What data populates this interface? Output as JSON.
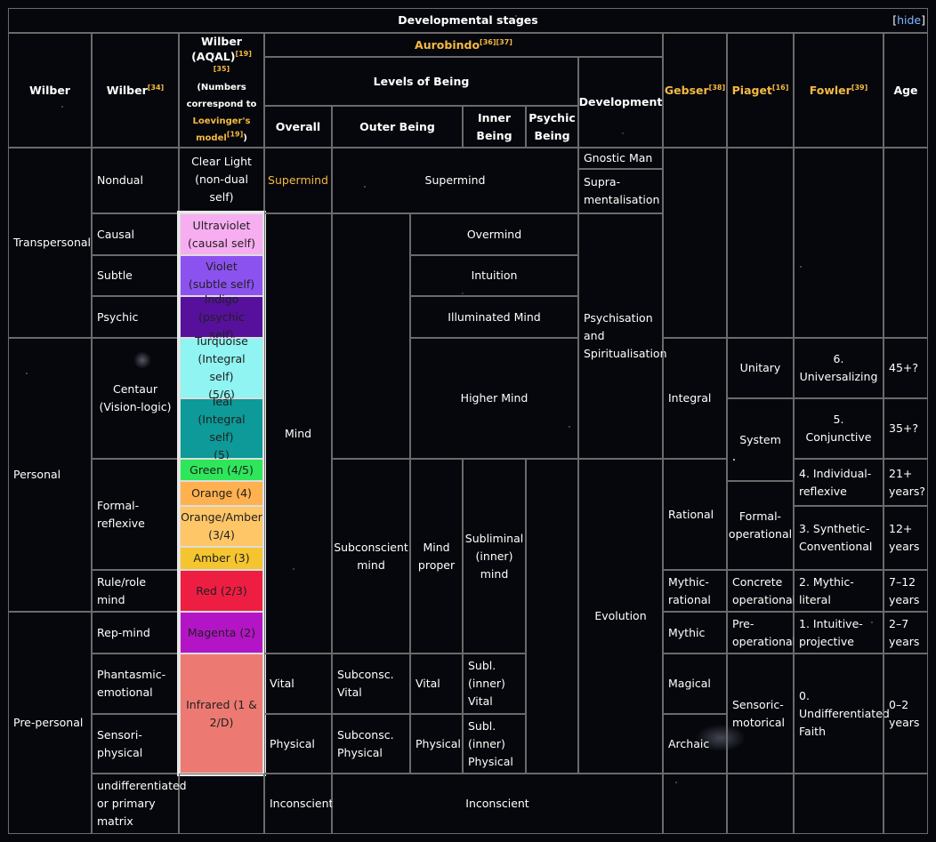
{
  "title": "Developmental stages",
  "hide_label": "hide",
  "headers": {
    "wilber1": "Wilber",
    "wilber34": "Wilber",
    "wilber34_ref": "[34]",
    "aqal": "Wilber\n(AQAL)",
    "aqal_ref": "[19][35]",
    "aqal_note1": "(Numbers\ncorrespond to",
    "aqal_note2": "Loevinger's\nmodel",
    "aqal_note_ref": "[19]",
    "aqal_note3": ")",
    "aurobindo": "Aurobindo",
    "aurobindo_ref": "[36][37]",
    "levels_of_being": "Levels of Being",
    "development": "Development",
    "overall": "Overall",
    "outer_being": "Outer Being",
    "inner_being": "Inner\nBeing",
    "psychic_being": "Psychic\nBeing",
    "gebser": "Gebser",
    "gebser_ref": "[38]",
    "piaget": "Piaget",
    "piaget_ref": "[16]",
    "fowler": "Fowler",
    "fowler_ref": "[39]",
    "age": "Age"
  },
  "wilber_col1": {
    "transpersonal": "Transpersonal",
    "personal": "Personal",
    "prepersonal": "Pre-personal"
  },
  "wilber_col2": {
    "nondual": "Nondual",
    "causal": "Causal",
    "subtle": "Subtle",
    "psychic": "Psychic",
    "centaur": "Centaur\n(Vision-logic)",
    "formal_reflexive": "Formal-\nreflexive",
    "rule_role": "Rule/role mind",
    "rep_mind": "Rep-mind",
    "phantasmic": "Phantasmic-\nemotional",
    "sensori": "Sensori-\nphysical",
    "undiff": "undifferentiated\nor primary\nmatrix"
  },
  "aqal": {
    "clear_light": "Clear Light\n(non-dual self)",
    "ultraviolet": "Ultraviolet\n(causal self)",
    "violet": "Violet\n(subtle self)",
    "indigo": "Indigo\n(psychic self)",
    "turquoise": "Turquoise\n(Integral self)\n(5/6)",
    "teal": "Teal\n(Integral self)\n(5)",
    "green": "Green (4/5)",
    "orange": "Orange (4)",
    "orange_amber": "Orange/Amber\n(3/4)",
    "amber": "Amber (3)",
    "red": "Red (2/3)",
    "magenta": "Magenta (2)",
    "infrared": "Infrared (1 &\n2/D)"
  },
  "colors": {
    "ultraviolet": "#f7aef0",
    "violet": "#8c52f0",
    "indigo": "#56109c",
    "turquoise": "#8ff4f2",
    "teal": "#0d9a98",
    "green": "#2ee65a",
    "orange": "#ffb150",
    "orange_amber": "#ffc668",
    "amber": "#f5c530",
    "red": "#ee1e43",
    "magenta": "#b315c6",
    "infrared": "#ec7a72"
  },
  "aurobindo": {
    "supermind_overall": "Supermind",
    "supermind": "Supermind",
    "gnostic_man": "Gnostic Man",
    "supramentalisation": "Supra-\nmentalisation",
    "overmind": "Overmind",
    "intuition": "Intuition",
    "illuminated_mind": "Illuminated Mind",
    "psychisation": "Psychisation\nand\nSpiritualisation",
    "higher_mind": "Higher Mind",
    "mind": "Mind",
    "subconscient_mind": "Subconscient\nmind",
    "mind_proper": "Mind\nproper",
    "subliminal_mind": "Subliminal\n(inner)\nmind",
    "evolution": "Evolution",
    "vital": "Vital",
    "subconsc_vital": "Subconsc.\nVital",
    "vital_proper": "Vital",
    "subl_vital": "Subl.\n(inner)\nVital",
    "physical": "Physical",
    "subconsc_physical": "Subconsc.\nPhysical",
    "physical_proper": "Physical",
    "subl_physical": "Subl.\n(inner)\nPhysical",
    "inconscient_overall": "Inconscient",
    "inconscient": "Inconscient"
  },
  "gebser": {
    "integral": "Integral",
    "rational": "Rational",
    "mythic_rational": "Mythic-\nrational",
    "mythic": "Mythic",
    "magical": "Magical",
    "archaic": "Archaic"
  },
  "piaget": {
    "unitary": "Unitary",
    "system": "System",
    "formal_operational": "Formal-\noperational",
    "concrete_operational": "Concrete\noperational",
    "pre_operational": "Pre-\noperational",
    "sensoric_motorical": "Sensoric-\nmotorical"
  },
  "fowler": {
    "f6": "6.\nUniversalizing",
    "f5": "5. Conjunctive",
    "f4": "4. Individual-\nreflexive",
    "f3": "3. Synthetic-\nConventional",
    "f2": "2. Mythic-\nliteral",
    "f1": "1. Intuitive-\nprojective",
    "f0": "0.\nUndifferentiated\nFaith"
  },
  "age": {
    "a45": "45+?",
    "a35": "35+?",
    "a21": "21+\nyears?",
    "a12": "12+\nyears",
    "a7": "7–12\nyears",
    "a2": "2–7\nyears",
    "a0": "0–2\nyears"
  }
}
